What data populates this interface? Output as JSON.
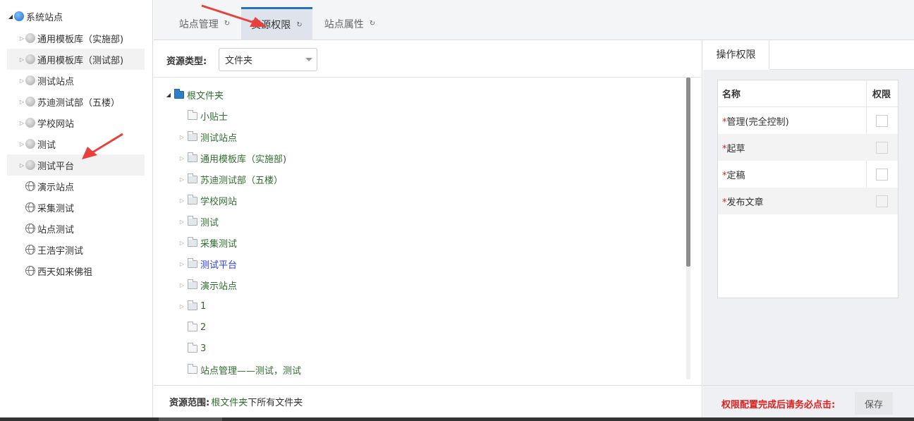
{
  "sidebar": {
    "root": "系统站点",
    "items": [
      {
        "label": "通用模板库（实施部)",
        "type": "gray"
      },
      {
        "label": "通用模板库（测试部)",
        "type": "gray"
      },
      {
        "label": "测试站点",
        "type": "gray"
      },
      {
        "label": "苏迪测试部（五楼）",
        "type": "gray"
      },
      {
        "label": "学校网站",
        "type": "gray"
      },
      {
        "label": "测试",
        "type": "gray"
      },
      {
        "label": "测试平台",
        "type": "gray"
      },
      {
        "label": "演示站点",
        "type": "line"
      },
      {
        "label": "采集测试",
        "type": "line"
      },
      {
        "label": "站点测试",
        "type": "line"
      },
      {
        "label": "王浩宇测试",
        "type": "line"
      },
      {
        "label": "西天如来佛祖",
        "type": "line"
      }
    ]
  },
  "tabs": [
    {
      "label": "站点管理"
    },
    {
      "label": "资源权限"
    },
    {
      "label": "站点属性"
    }
  ],
  "filter": {
    "label": "资源类型:",
    "selected": "文件夹"
  },
  "tree": {
    "root": "根文件夹",
    "items": [
      {
        "label": "小贴士",
        "expandable": false
      },
      {
        "label": "测试站点",
        "expandable": true
      },
      {
        "label": "通用模板库（实施部)",
        "expandable": true
      },
      {
        "label": "苏迪测试部（五楼）",
        "expandable": true
      },
      {
        "label": "学校网站",
        "expandable": true
      },
      {
        "label": "测试",
        "expandable": true
      },
      {
        "label": "采集测试",
        "expandable": true
      },
      {
        "label": "测试平台",
        "expandable": true,
        "highlight": true
      },
      {
        "label": "演示站点",
        "expandable": true
      },
      {
        "label": "1",
        "expandable": true
      },
      {
        "label": "2",
        "expandable": false
      },
      {
        "label": "3",
        "expandable": false
      },
      {
        "label": "站点管理——测试，测试",
        "expandable": false
      }
    ]
  },
  "scope": {
    "label": "资源范围:",
    "root_link": "根文件夹",
    "suffix": "下所有文件夹"
  },
  "permissions": {
    "tab": "操作权限",
    "col_name": "名称",
    "col_perm": "权限",
    "rows": [
      {
        "label": "管理(完全控制)"
      },
      {
        "label": "起草"
      },
      {
        "label": "定稿"
      },
      {
        "label": "发布文章"
      }
    ]
  },
  "footer": {
    "warning": "权限配置完成后请务必点击:",
    "save": "保存"
  },
  "colors": {
    "accent": "#2a72b8",
    "tree_text": "#2f6f2f",
    "highlight_text": "#2a3fdc",
    "warning": "#e02020",
    "arrow": "#e8413b"
  }
}
